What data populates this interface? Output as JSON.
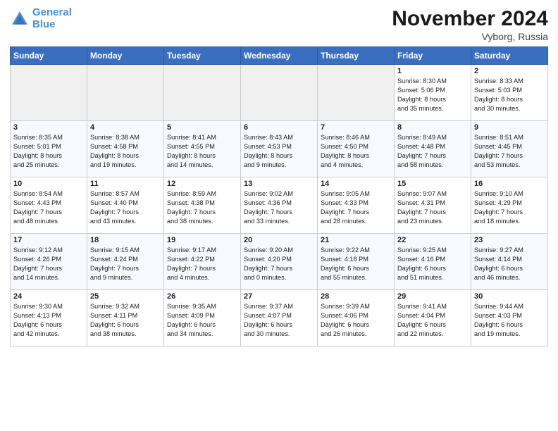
{
  "header": {
    "logo_line1": "General",
    "logo_line2": "Blue",
    "title": "November 2024",
    "location": "Vyborg, Russia"
  },
  "weekdays": [
    "Sunday",
    "Monday",
    "Tuesday",
    "Wednesday",
    "Thursday",
    "Friday",
    "Saturday"
  ],
  "weeks": [
    [
      {
        "day": "",
        "info": ""
      },
      {
        "day": "",
        "info": ""
      },
      {
        "day": "",
        "info": ""
      },
      {
        "day": "",
        "info": ""
      },
      {
        "day": "",
        "info": ""
      },
      {
        "day": "1",
        "info": "Sunrise: 8:30 AM\nSunset: 5:06 PM\nDaylight: 8 hours\nand 35 minutes."
      },
      {
        "day": "2",
        "info": "Sunrise: 8:33 AM\nSunset: 5:03 PM\nDaylight: 8 hours\nand 30 minutes."
      }
    ],
    [
      {
        "day": "3",
        "info": "Sunrise: 8:35 AM\nSunset: 5:01 PM\nDaylight: 8 hours\nand 25 minutes."
      },
      {
        "day": "4",
        "info": "Sunrise: 8:38 AM\nSunset: 4:58 PM\nDaylight: 8 hours\nand 19 minutes."
      },
      {
        "day": "5",
        "info": "Sunrise: 8:41 AM\nSunset: 4:55 PM\nDaylight: 8 hours\nand 14 minutes."
      },
      {
        "day": "6",
        "info": "Sunrise: 8:43 AM\nSunset: 4:53 PM\nDaylight: 8 hours\nand 9 minutes."
      },
      {
        "day": "7",
        "info": "Sunrise: 8:46 AM\nSunset: 4:50 PM\nDaylight: 8 hours\nand 4 minutes."
      },
      {
        "day": "8",
        "info": "Sunrise: 8:49 AM\nSunset: 4:48 PM\nDaylight: 7 hours\nand 58 minutes."
      },
      {
        "day": "9",
        "info": "Sunrise: 8:51 AM\nSunset: 4:45 PM\nDaylight: 7 hours\nand 53 minutes."
      }
    ],
    [
      {
        "day": "10",
        "info": "Sunrise: 8:54 AM\nSunset: 4:43 PM\nDaylight: 7 hours\nand 48 minutes."
      },
      {
        "day": "11",
        "info": "Sunrise: 8:57 AM\nSunset: 4:40 PM\nDaylight: 7 hours\nand 43 minutes."
      },
      {
        "day": "12",
        "info": "Sunrise: 8:59 AM\nSunset: 4:38 PM\nDaylight: 7 hours\nand 38 minutes."
      },
      {
        "day": "13",
        "info": "Sunrise: 9:02 AM\nSunset: 4:36 PM\nDaylight: 7 hours\nand 33 minutes."
      },
      {
        "day": "14",
        "info": "Sunrise: 9:05 AM\nSunset: 4:33 PM\nDaylight: 7 hours\nand 28 minutes."
      },
      {
        "day": "15",
        "info": "Sunrise: 9:07 AM\nSunset: 4:31 PM\nDaylight: 7 hours\nand 23 minutes."
      },
      {
        "day": "16",
        "info": "Sunrise: 9:10 AM\nSunset: 4:29 PM\nDaylight: 7 hours\nand 18 minutes."
      }
    ],
    [
      {
        "day": "17",
        "info": "Sunrise: 9:12 AM\nSunset: 4:26 PM\nDaylight: 7 hours\nand 14 minutes."
      },
      {
        "day": "18",
        "info": "Sunrise: 9:15 AM\nSunset: 4:24 PM\nDaylight: 7 hours\nand 9 minutes."
      },
      {
        "day": "19",
        "info": "Sunrise: 9:17 AM\nSunset: 4:22 PM\nDaylight: 7 hours\nand 4 minutes."
      },
      {
        "day": "20",
        "info": "Sunrise: 9:20 AM\nSunset: 4:20 PM\nDaylight: 7 hours\nand 0 minutes."
      },
      {
        "day": "21",
        "info": "Sunrise: 9:22 AM\nSunset: 4:18 PM\nDaylight: 6 hours\nand 55 minutes."
      },
      {
        "day": "22",
        "info": "Sunrise: 9:25 AM\nSunset: 4:16 PM\nDaylight: 6 hours\nand 51 minutes."
      },
      {
        "day": "23",
        "info": "Sunrise: 9:27 AM\nSunset: 4:14 PM\nDaylight: 6 hours\nand 46 minutes."
      }
    ],
    [
      {
        "day": "24",
        "info": "Sunrise: 9:30 AM\nSunset: 4:13 PM\nDaylight: 6 hours\nand 42 minutes."
      },
      {
        "day": "25",
        "info": "Sunrise: 9:32 AM\nSunset: 4:11 PM\nDaylight: 6 hours\nand 38 minutes."
      },
      {
        "day": "26",
        "info": "Sunrise: 9:35 AM\nSunset: 4:09 PM\nDaylight: 6 hours\nand 34 minutes."
      },
      {
        "day": "27",
        "info": "Sunrise: 9:37 AM\nSunset: 4:07 PM\nDaylight: 6 hours\nand 30 minutes."
      },
      {
        "day": "28",
        "info": "Sunrise: 9:39 AM\nSunset: 4:06 PM\nDaylight: 6 hours\nand 26 minutes."
      },
      {
        "day": "29",
        "info": "Sunrise: 9:41 AM\nSunset: 4:04 PM\nDaylight: 6 hours\nand 22 minutes."
      },
      {
        "day": "30",
        "info": "Sunrise: 9:44 AM\nSunset: 4:03 PM\nDaylight: 6 hours\nand 19 minutes."
      }
    ]
  ]
}
